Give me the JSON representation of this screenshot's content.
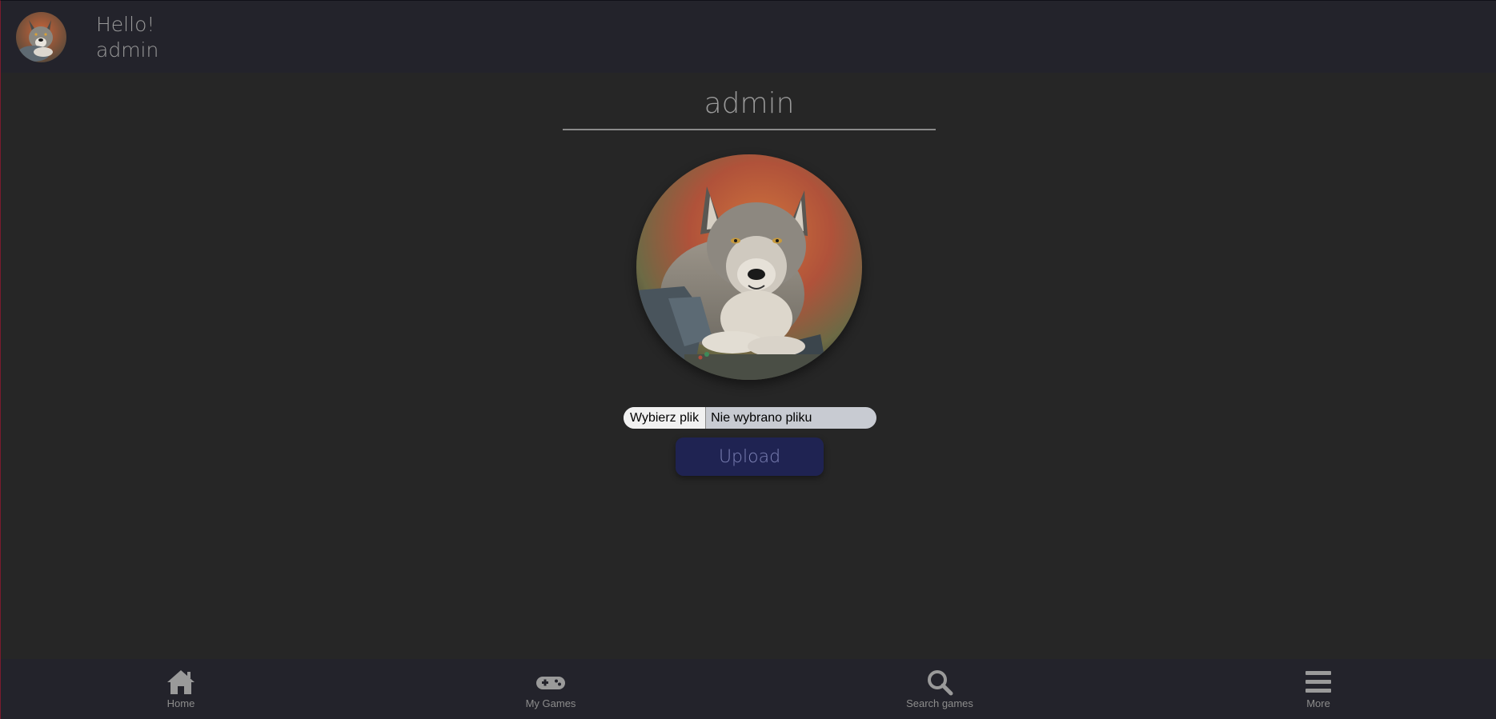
{
  "header": {
    "greeting": "Hello!",
    "username": "admin"
  },
  "profile": {
    "name": "admin",
    "avatar_alt": "wolf"
  },
  "upload": {
    "choose_label": "Wybierz plik",
    "status_text": "Nie wybrano pliku",
    "button_label": "Upload"
  },
  "nav": {
    "items": [
      {
        "label": "Home",
        "icon": "home-icon"
      },
      {
        "label": "My Games",
        "icon": "gamepad-icon"
      },
      {
        "label": "Search games",
        "icon": "search-icon"
      },
      {
        "label": "More",
        "icon": "menu-icon"
      }
    ]
  },
  "colors": {
    "background": "#262626",
    "bar": "#23232b",
    "accent_button": "#1f2352",
    "text": "#9a9a9a"
  }
}
